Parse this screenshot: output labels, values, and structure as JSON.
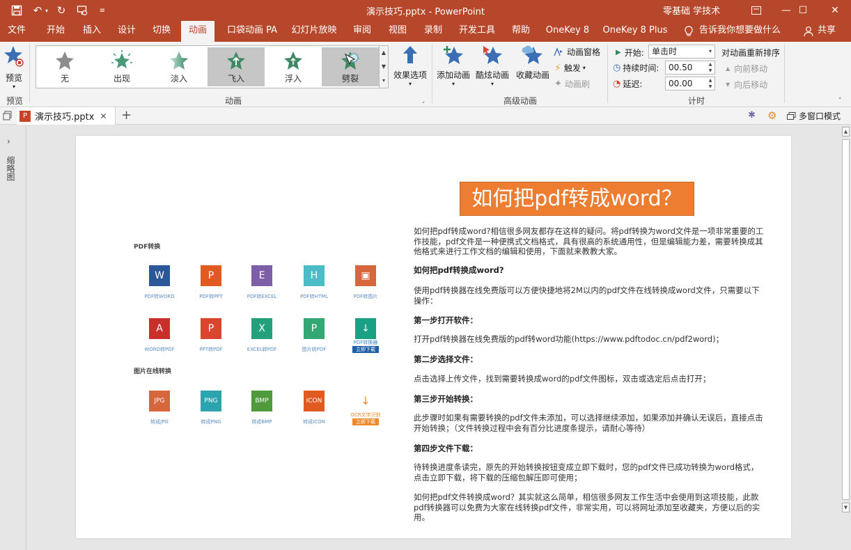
{
  "window": {
    "title": "演示技巧.pptx  -  PowerPoint",
    "account": "零基础 学技术"
  },
  "tabs": [
    "文件",
    "开始",
    "插入",
    "设计",
    "切换",
    "动画",
    "口袋动画 PA",
    "幻灯片放映",
    "审阅",
    "视图",
    "录制",
    "开发工具",
    "帮助",
    "OneKey 8",
    "OneKey 8 Plus"
  ],
  "active_tab": "动画",
  "tell_me": "告诉我你想要做什么",
  "share": "共享",
  "ribbon": {
    "preview_label": "预览",
    "preview_group": "预览",
    "animation_group": "动画",
    "gallery": [
      "无",
      "出现",
      "淡入",
      "飞入",
      "浮入",
      "劈裂"
    ],
    "effect_options": "效果选项",
    "add_animation": "添加动画",
    "cool_animation": "酷炫动画",
    "fav_animation": "收藏动画",
    "animation_pane": "动画窗格",
    "trigger": "触发",
    "animation_painter": "动画刷",
    "advanced_group": "高级动画",
    "start_label": "开始:",
    "start_value": "单击时",
    "duration_label": "持续时间:",
    "duration_value": "00.50",
    "delay_label": "延迟:",
    "delay_value": "00.00",
    "timing_group": "计时",
    "reorder_title": "对动画重新排序",
    "move_earlier": "向前移动",
    "move_later": "向后移动"
  },
  "doc_tab": "演示技巧.pptx",
  "multi_window": "多窗口模式",
  "thumbnail_label": "缩略图",
  "slide": {
    "title": "如何把pdf转成word？",
    "paragraphs": [
      {
        "text": "如何把pdf转成word?相信很多网友都存在这样的疑问。将pdf转换为word文件是一项非常重要的工作技能，pdf文件是一种便携式文档格式，具有很高的系统通用性，但是编辑能力差，需要转换成其他格式来进行工作文档的编辑和使用，下面就来教教大家。",
        "bold": false
      },
      {
        "text": "如何把pdf转换成word?",
        "bold": true
      },
      {
        "text": "使用pdf转换器在线免费版可以方便快捷地将2M以内的pdf文件在线转换成word文件，只需要以下操作：",
        "bold": false
      },
      {
        "text": "第一步打开软件：",
        "bold": true
      },
      {
        "text": "打开pdf转换器在线免费版的pdf转word功能(https://www.pdftodoc.cn/pdf2word)；",
        "bold": false
      },
      {
        "text": "第二步选择文件：",
        "bold": true
      },
      {
        "text": "点击选择上传文件，找到需要转换成word的pdf文件图标，双击或选定后点击打开；",
        "bold": false
      },
      {
        "text": "第三步开始转换：",
        "bold": true
      },
      {
        "text": "此步骤时如果有需要转换的pdf文件未添加，可以选择继续添加，如果添加并确认无误后，直接点击开始转换；（文件转换过程中会有百分比进度条提示，请耐心等待）",
        "bold": false
      },
      {
        "text": "第四步文件下载：",
        "bold": true
      },
      {
        "text": "待转换进度条读完，原先的开始转换按钮变成立即下载时，您的pdf文件已成功转换为word格式，点击立即下载，将下载的压缩包解压即可使用；",
        "bold": false
      },
      {
        "text": "如何把pdf文件转换成word？其实就这么简单，相信很多网友工作生活中会使用到这项技能，此款pdf转换器可以免费为大家在线转换pdf文件，非常实用，可以将网址添加至收藏夹，方便以后的实用。",
        "bold": false
      }
    ],
    "pdf_section": "PDF转换",
    "img_section": "图片在线转换",
    "icons_row1": [
      {
        "label": "PDF转WORD",
        "glyph": "W",
        "color": "#2b5797"
      },
      {
        "label": "PDF转PPT",
        "glyph": "P",
        "color": "#e05a22"
      },
      {
        "label": "PDF转EXCEL",
        "glyph": "E",
        "color": "#7f5ea8"
      },
      {
        "label": "PDF转HTML",
        "glyph": "H",
        "color": "#4bbcc8"
      },
      {
        "label": "PDF转图片",
        "glyph": "▣",
        "color": "#d8663d"
      }
    ],
    "icons_row2": [
      {
        "label": "WORD转PDF",
        "glyph": "A",
        "color": "#c9302c"
      },
      {
        "label": "PPT转PDF",
        "glyph": "P",
        "color": "#d9452f"
      },
      {
        "label": "EXCEL转PDF",
        "glyph": "X",
        "color": "#24a07c"
      },
      {
        "label": "图片转PDF",
        "glyph": "P",
        "color": "#34a874"
      },
      {
        "label": "PDF转换器",
        "glyph": "↓",
        "color": "#1aa085",
        "badge": "立即下载"
      }
    ],
    "icons_row3": [
      {
        "label": "转成JPG",
        "glyph": "JPG",
        "color": "#d8663d"
      },
      {
        "label": "转成PNG",
        "glyph": "PNG",
        "color": "#2ba4b0"
      },
      {
        "label": "转成BMP",
        "glyph": "BMP",
        "color": "#4f9a3c"
      },
      {
        "label": "转成ICON",
        "glyph": "ICON",
        "color": "#e05a22"
      },
      {
        "label": "OCR文字识别",
        "glyph": "↓",
        "color": "#ffffff",
        "badge": "立即下载"
      }
    ]
  },
  "colors": {
    "accent": "#b7472a",
    "title_fill": "#ed7d31",
    "star": "#3b6fb5"
  }
}
